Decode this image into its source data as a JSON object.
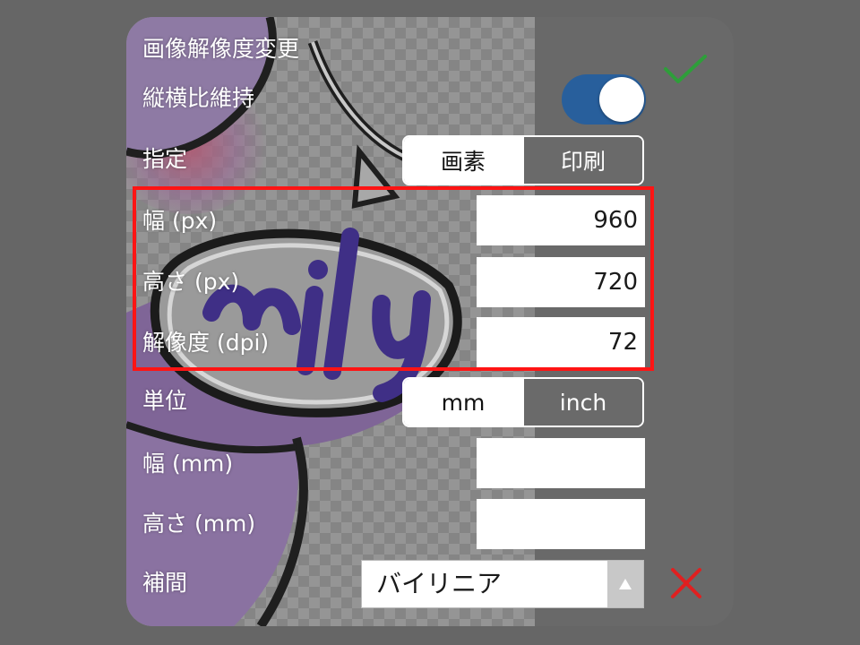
{
  "dialog": {
    "title": "画像解像度変更",
    "aspect_ratio": {
      "label": "縦横比維持",
      "on": true
    },
    "spec": {
      "label": "指定",
      "options": [
        "画素",
        "印刷"
      ],
      "selected": "画素"
    },
    "width_px": {
      "label": "幅 (px)",
      "value": "960"
    },
    "height_px": {
      "label": "高さ (px)",
      "value": "720"
    },
    "resolution": {
      "label": "解像度 (dpi)",
      "value": "72"
    },
    "unit": {
      "label": "単位",
      "options": [
        "mm",
        "inch"
      ],
      "selected": "mm"
    },
    "width_mm": {
      "label": "幅 (mm)",
      "value": ""
    },
    "height_mm": {
      "label": "高さ (mm)",
      "value": ""
    },
    "interpolation": {
      "label": "補間",
      "value": "バイリニア"
    }
  },
  "icons": {
    "confirm": "check-icon",
    "cancel": "close-icon",
    "dropdown": "triangle-up-icon"
  },
  "colors": {
    "toggle_on": "#285f9c",
    "confirm": "#2e9e3a",
    "cancel": "#e02020",
    "highlight": "#ff1414"
  }
}
